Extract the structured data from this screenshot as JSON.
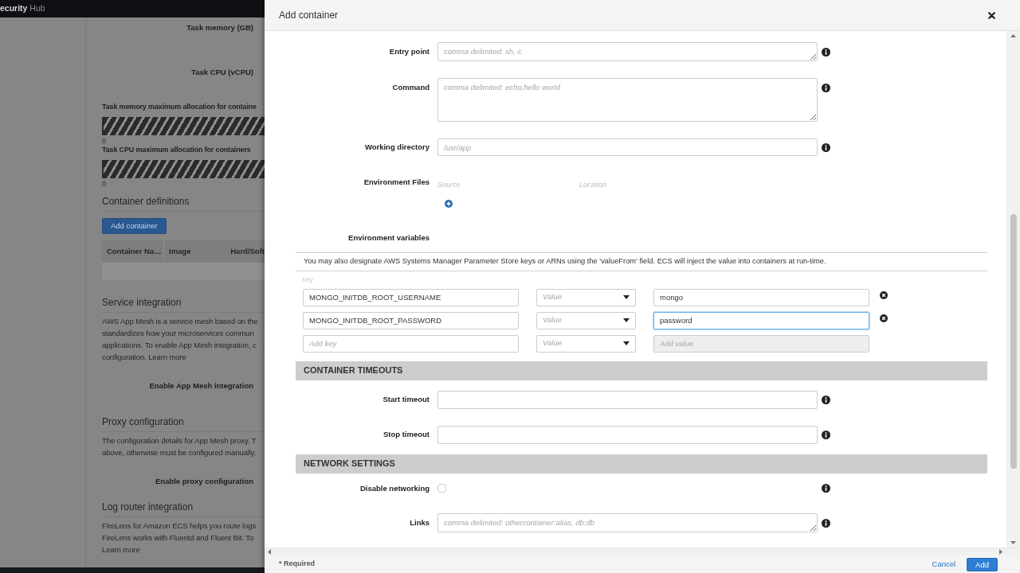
{
  "background_page": {
    "nav": {
      "service": "ecurity",
      "suffix": "Hub"
    },
    "task_size_labels": [
      "Task memory (GB)",
      "Task CPU (vCPU)"
    ],
    "allocations": [
      {
        "label": "Task memory maximum allocation for containe",
        "reading": "0"
      },
      {
        "label": "Task CPU maximum allocation for containers",
        "reading": "0"
      }
    ],
    "container_definitions": {
      "heading": "Container definitions",
      "button": "Add container",
      "columns": [
        "Container Na…",
        "Image",
        "Hard/Soft"
      ]
    },
    "sections": [
      {
        "heading": "Service integration",
        "lines": [
          {
            "text": "AWS App Mesh is a service mesh based on the"
          },
          {
            "text": "standardizes how your microservices commun"
          },
          {
            "text": "applications. To enable App Mesh integration, c"
          },
          {
            "text": "configuration.",
            "link": "Learn more"
          }
        ],
        "toggle": "Enable App Mesh integration"
      },
      {
        "heading": "Proxy configuration",
        "lines": [
          {
            "text": "The configuration details for App Mesh proxy. T"
          },
          {
            "text": "above, otherwise must be configured manually."
          }
        ],
        "toggle": "Enable proxy configuration"
      },
      {
        "heading": "Log router integration",
        "lines": [
          {
            "text": "FireLens for Amazon ECS helps you route logs"
          },
          {
            "text": "FireLens works with Fluentd and Fluent Bit. To"
          },
          {
            "link": "Learn more"
          }
        ]
      }
    ]
  },
  "modal": {
    "title": "Add container",
    "form": [
      {
        "kind": "textarea_short",
        "label": "Entry point",
        "placeholder": "comma delimited: sh,-c",
        "info": true
      },
      {
        "kind": "textarea",
        "label": "Command",
        "placeholder": "comma delimited: echo,hello world",
        "info": true
      },
      {
        "kind": "text",
        "label": "Working directory",
        "placeholder": "/usr/app",
        "info": true
      },
      {
        "kind": "files",
        "label": "Environment Files",
        "columns": [
          "Source",
          "Location"
        ],
        "info": false
      },
      {
        "kind": "env_vars",
        "label": "Environment variables",
        "note": "You may also designate AWS Systems Manager Parameter Store keys or ARNs using the 'valueFrom' field. ECS will inject the value into containers at run-time.",
        "key_header": "Key",
        "rows": [
          {
            "key": "MONGO_INITDB_ROOT_USERNAME",
            "type_placeholder": "Value",
            "value": "mongo",
            "focused": false,
            "value_disabled": false,
            "removable": true
          },
          {
            "key": "MONGO_INITDB_ROOT_PASSWORD",
            "type_placeholder": "Value",
            "value": "password",
            "focused": true,
            "value_disabled": false,
            "removable": true
          },
          {
            "key_placeholder": "Add key",
            "type_placeholder": "Value",
            "value_placeholder": "Add value",
            "focused": false,
            "value_disabled": true,
            "removable": false
          }
        ]
      },
      {
        "kind": "section",
        "heading": "CONTAINER TIMEOUTS"
      },
      {
        "kind": "text",
        "label": "Start timeout",
        "info": true
      },
      {
        "kind": "text",
        "label": "Stop timeout",
        "info": true
      },
      {
        "kind": "section",
        "heading": "NETWORK SETTINGS"
      },
      {
        "kind": "checkbox",
        "label": "Disable networking",
        "checked": false,
        "info": true
      },
      {
        "kind": "textarea_short",
        "label": "Links",
        "placeholder": "comma delimited: othercontainer:alias, db:db",
        "info": true
      }
    ],
    "footer": {
      "required_note": "* Required",
      "cancel": "Cancel",
      "submit": "Add"
    }
  }
}
